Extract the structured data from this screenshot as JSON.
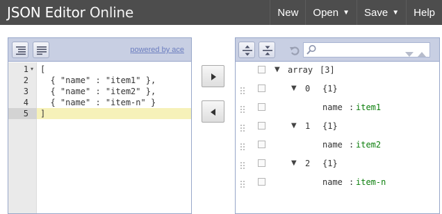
{
  "app": {
    "title_main": "JSON Editor",
    "title_light": " Online"
  },
  "menu": {
    "new_label": "New",
    "open_label": "Open",
    "save_label": "Save",
    "help_label": "Help",
    "caret": "▼"
  },
  "left_panel": {
    "powered_by": "powered by ace",
    "line_numbers": [
      "1",
      "2",
      "3",
      "4",
      "5"
    ],
    "fold_marker": "▾",
    "lines": [
      "[",
      "  { \"name\" : \"item1\" },",
      "  { \"name\" : \"item2\" },",
      "  { \"name\" : \"item-n\" }",
      "]"
    ],
    "active_line": 5
  },
  "right_panel": {
    "tree": [
      {
        "toggle": "▼",
        "key": "array",
        "info": "[3]"
      },
      {
        "toggle": "▼",
        "key": "0",
        "info": "{1}"
      },
      {
        "field": "name",
        "sep": ":",
        "value": "item1"
      },
      {
        "toggle": "▼",
        "key": "1",
        "info": "{1}"
      },
      {
        "field": "name",
        "sep": ":",
        "value": "item2"
      },
      {
        "toggle": "▼",
        "key": "2",
        "info": "{1}"
      },
      {
        "field": "name",
        "sep": ":",
        "value": "item-n"
      }
    ]
  },
  "colors": {
    "header_bg": "#4d4d4d",
    "toolbar_bg": "#c8cfe3",
    "panel_border": "#97a6c9",
    "string_green": "#1a7a1a",
    "active_line": "#f6f1b9"
  },
  "icons": {
    "format": "format-icon",
    "compact": "compact-icon",
    "to_tree": "arrow-right-icon",
    "to_code": "arrow-left-icon",
    "expand_all": "expand-all-icon",
    "collapse_all": "collapse-all-icon",
    "undo": "undo-icon",
    "search": "search-icon",
    "search_next": "chevron-down-icon",
    "search_prev": "chevron-up-icon"
  }
}
